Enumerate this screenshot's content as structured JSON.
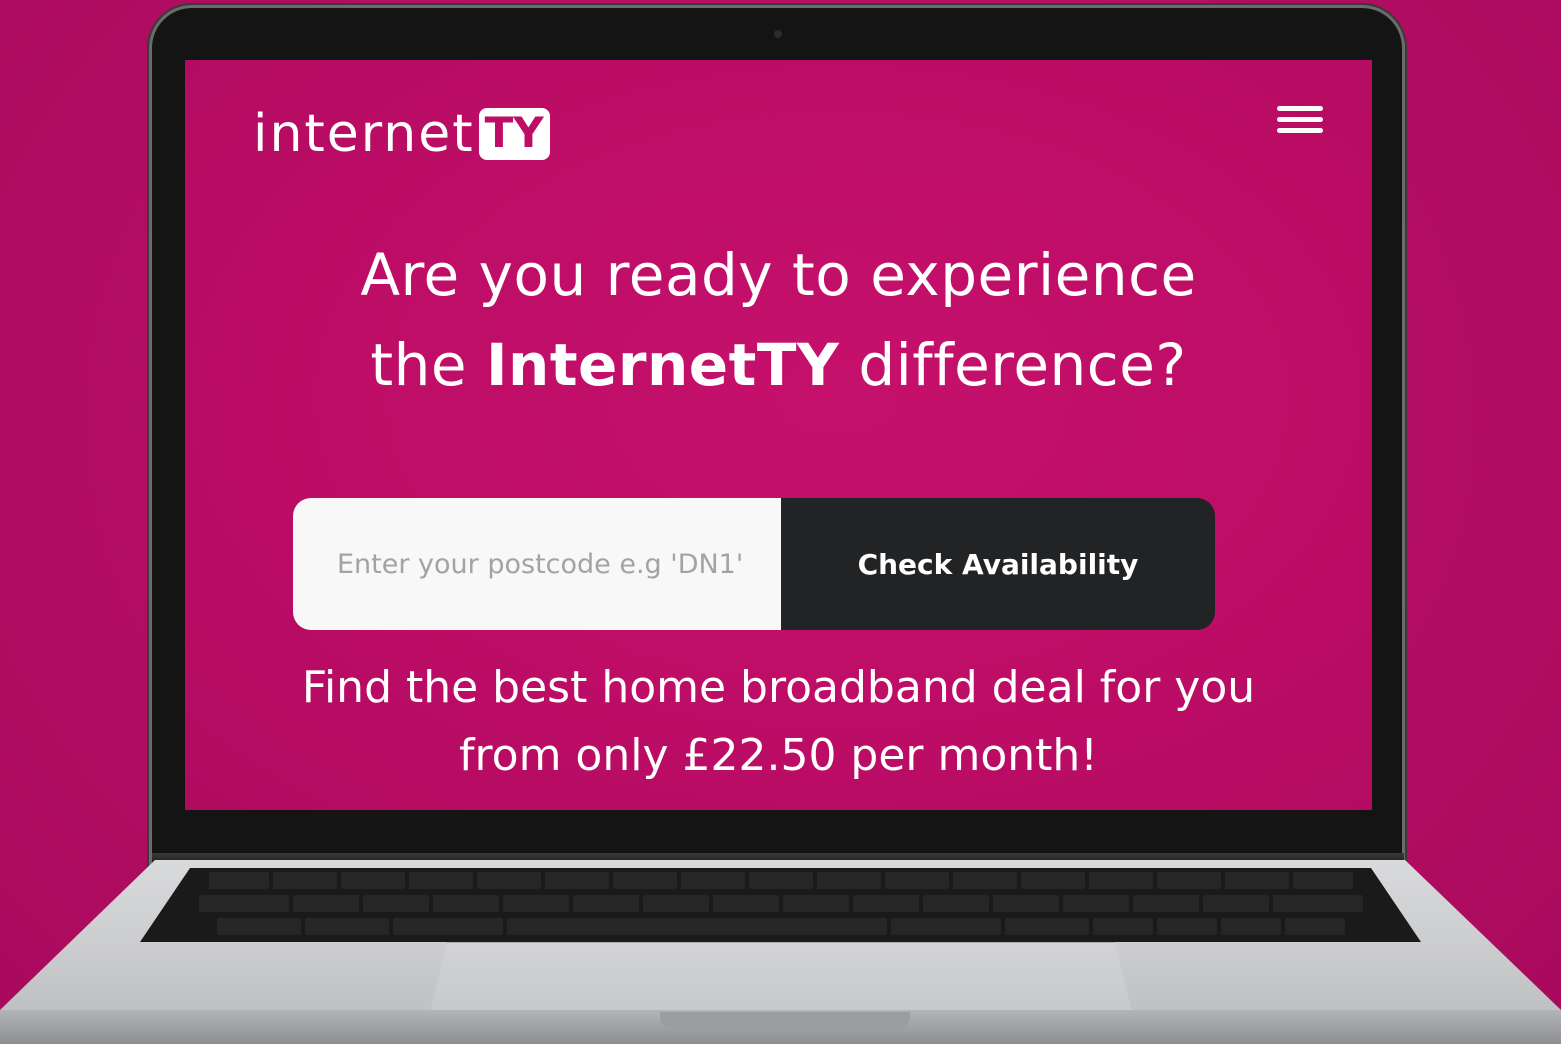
{
  "header": {
    "logo_text": "internet",
    "logo_badge": "TY",
    "menu_icon": "hamburger-menu-icon"
  },
  "hero": {
    "headline_line1": "Are you ready to experience",
    "headline_pre": "the ",
    "headline_brand": "InternetTY",
    "headline_post": " difference?"
  },
  "search": {
    "placeholder": "Enter your postcode e.g 'DN1'",
    "button_label": "Check Availability"
  },
  "tagline": {
    "line1": "Find the best home broadband deal for you",
    "line2": "from only £22.50 per month!"
  },
  "colors": {
    "background": "#b80e66",
    "screen": "#bd0d66",
    "button": "#222325",
    "input": "#f8f8f8",
    "text": "#ffffff"
  }
}
